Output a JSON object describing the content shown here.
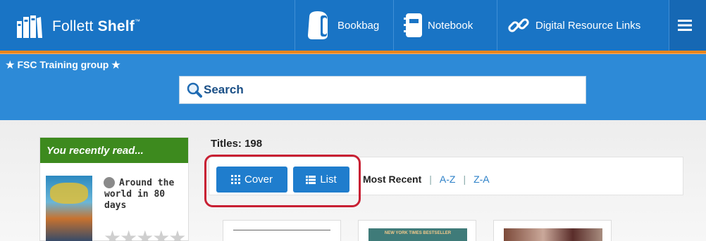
{
  "app": {
    "name_regular": "Follett ",
    "name_bold": "Shelf",
    "trademark": "™",
    "brand_color": "#1974c5",
    "accent_color": "#e8851b"
  },
  "nav": {
    "bookbag": "Bookbag",
    "notebook": "Notebook",
    "digital": "Digital Resource Links",
    "menu_icon": "hamburger-menu-icon"
  },
  "banner": {
    "group_title": "★ FSC Training group ★"
  },
  "search": {
    "placeholder": "Search"
  },
  "recent": {
    "heading": "You recently read...",
    "book_title": "Around the world in 80 days",
    "rating_stars": "★★★★★",
    "header_color": "#3d8a1e"
  },
  "results": {
    "titles_count": "Titles: 198"
  },
  "view": {
    "cover_label": "Cover",
    "list_label": "List"
  },
  "sort": {
    "most_recent": "Most Recent",
    "sep": "|",
    "az": "A-Z",
    "za": "Z-A"
  },
  "cards": {
    "card2_text": "NEW YORK TIMES BESTSELLER"
  }
}
